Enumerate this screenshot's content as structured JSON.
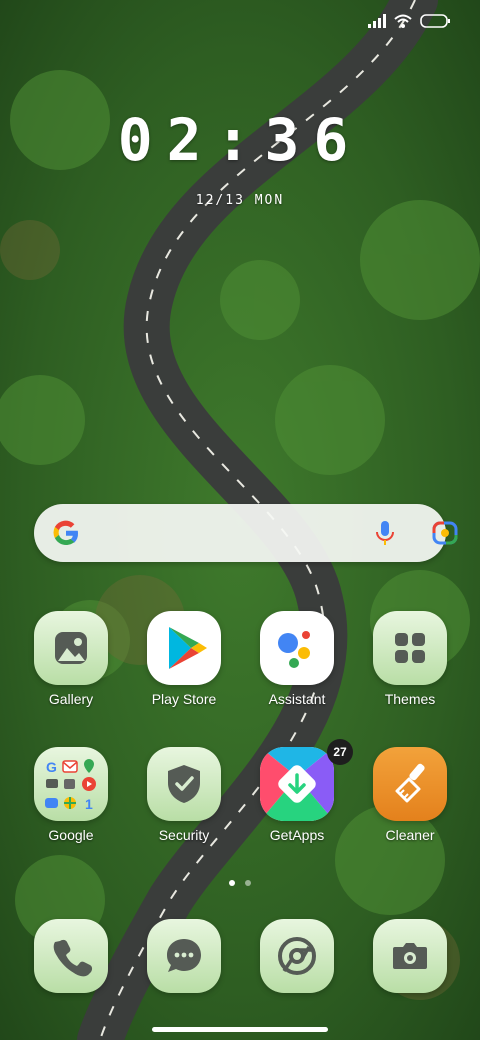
{
  "status_bar": {
    "icons": [
      "signal-icon",
      "wifi-icon",
      "battery-icon"
    ]
  },
  "clock": {
    "time": "02:36",
    "date": "12/13 MON"
  },
  "search": {
    "logo": "google-g-icon",
    "mic": "mic-icon",
    "lens": "google-lens-icon"
  },
  "apps": [
    {
      "label": "Gallery",
      "icon": "gallery-icon"
    },
    {
      "label": "Play Store",
      "icon": "play-store-icon"
    },
    {
      "label": "Assistant",
      "icon": "assistant-icon"
    },
    {
      "label": "Themes",
      "icon": "themes-icon"
    },
    {
      "label": "Google",
      "icon": "google-folder-icon"
    },
    {
      "label": "Security",
      "icon": "shield-check-icon"
    },
    {
      "label": "GetApps",
      "icon": "getapps-icon",
      "badge": "27"
    },
    {
      "label": "Cleaner",
      "icon": "broom-icon"
    }
  ],
  "page_indicator": {
    "pages": 2,
    "current": 1
  },
  "dock": [
    {
      "icon": "phone-icon"
    },
    {
      "icon": "messages-icon"
    },
    {
      "icon": "chrome-icon"
    },
    {
      "icon": "camera-icon"
    }
  ],
  "colors": {
    "tile_green_top": "#e8f6df",
    "tile_green_bottom": "#b9dea6",
    "icon_dark": "#555b55"
  }
}
